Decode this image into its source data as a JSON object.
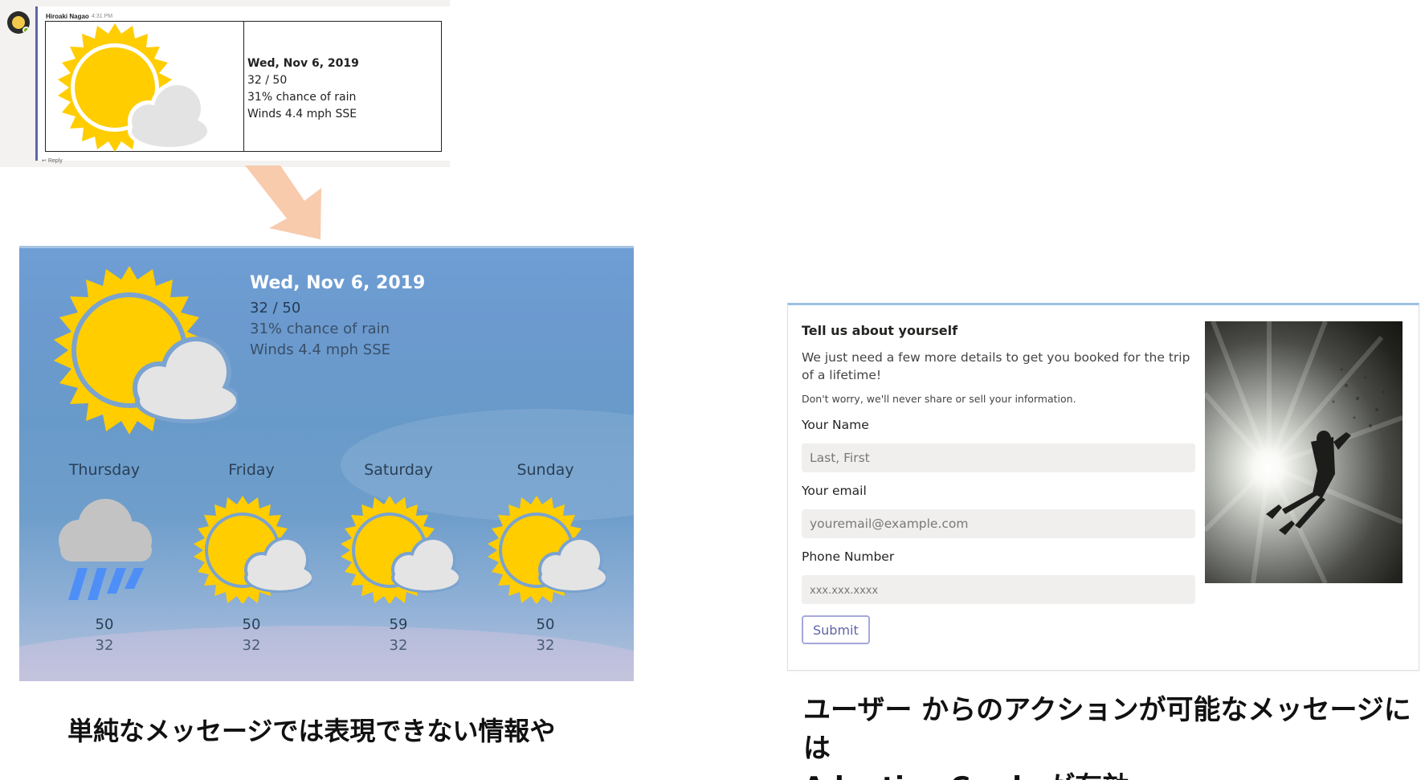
{
  "teams_message": {
    "sender": "Hiroaki Nagao",
    "time": "4:31 PM",
    "reply_label": "Reply",
    "card": {
      "date": "Wed, Nov 6, 2019",
      "temps": "32 / 50",
      "rain": "31% chance of rain",
      "winds": "Winds 4.4 mph SSE",
      "icon": "partly-cloudy-icon"
    }
  },
  "weather_card": {
    "date": "Wed, Nov 6, 2019",
    "temps": "32 / 50",
    "rain": "31% chance of rain",
    "winds": "Winds 4.4 mph SSE",
    "icon": "partly-cloudy-icon",
    "forecast": [
      {
        "day": "Thursday",
        "high": "50",
        "low": "32",
        "icon": "rain-cloud-icon"
      },
      {
        "day": "Friday",
        "high": "50",
        "low": "32",
        "icon": "partly-cloudy-icon"
      },
      {
        "day": "Saturday",
        "high": "59",
        "low": "32",
        "icon": "partly-cloudy-icon"
      },
      {
        "day": "Sunday",
        "high": "50",
        "low": "32",
        "icon": "partly-cloudy-icon"
      }
    ]
  },
  "form_card": {
    "title": "Tell us about yourself",
    "description": "We just need a few more details to get you booked for the trip of a lifetime!",
    "note": "Don't worry, we'll never share or sell your information.",
    "fields": [
      {
        "label": "Your Name",
        "placeholder": "Last, First"
      },
      {
        "label": "Your email",
        "placeholder": "youremail@example.com"
      },
      {
        "label": "Phone Number",
        "placeholder": "xxx.xxx.xxxx"
      }
    ],
    "submit_label": "Submit",
    "image": "scuba-diver-photo"
  },
  "captions": {
    "left": "単純なメッセージでは表現できない情報や",
    "right_line1": "ユーザー からのアクションが可能なメッセージには",
    "right_line2": "Adaptive Cards が有効"
  },
  "colors": {
    "teams_accent": "#6264a7",
    "sun": "#ffcd00",
    "cloud": "#e6e6e6",
    "arrow": "#f8cbad"
  }
}
